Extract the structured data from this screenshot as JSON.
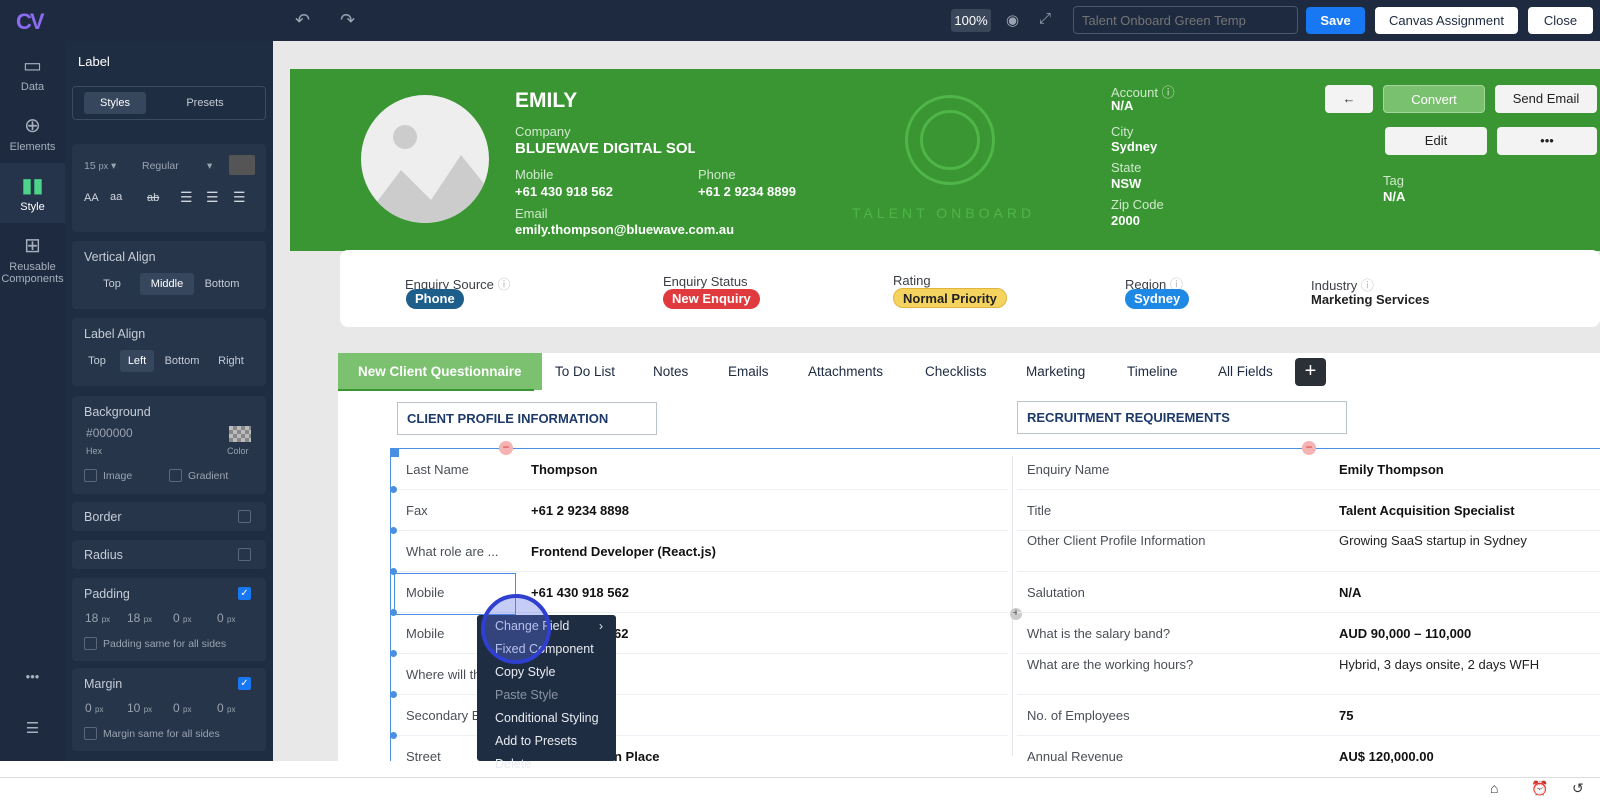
{
  "app": {
    "logo": "CV"
  },
  "toolbar": {
    "zoom": "100%",
    "template_placeholder": "Talent Onboard Green Temp",
    "save": "Save",
    "canvas_assignment": "Canvas Assignment",
    "close": "Close"
  },
  "leftnav": {
    "items": [
      {
        "label": "Data",
        "icon": "data-icon"
      },
      {
        "label": "Elements",
        "icon": "plus-circle-icon"
      },
      {
        "label": "Style",
        "icon": "style-icon"
      },
      {
        "label": "Reusable Components",
        "icon": "components-icon"
      }
    ],
    "more": "•••",
    "menu": "☰"
  },
  "panel": {
    "title": "Label",
    "tabs": [
      "Styles",
      "Presets"
    ],
    "font_size": "15",
    "font_unit": "px",
    "font_weight": "Regular",
    "vertical_align": {
      "title": "Vertical Align",
      "options": [
        "Top",
        "Middle",
        "Bottom"
      ],
      "selected": "Middle"
    },
    "label_align": {
      "title": "Label Align",
      "options": [
        "Top",
        "Left",
        "Bottom",
        "Right"
      ],
      "selected": "Left"
    },
    "background": {
      "title": "Background",
      "hex": "000000",
      "hex_label": "Hex",
      "color_label": "Color",
      "image": "Image",
      "gradient": "Gradient"
    },
    "border": "Border",
    "radius": "Radius",
    "padding": {
      "title": "Padding",
      "values": [
        "18",
        "18",
        "0",
        "0"
      ],
      "unit": "px",
      "same": "Padding same for all sides"
    },
    "margin": {
      "title": "Margin",
      "values": [
        "0",
        "10",
        "0",
        "0"
      ],
      "unit": "px",
      "same": "Margin same for all sides"
    }
  },
  "header": {
    "name": "EMILY",
    "company_label": "Company",
    "company": "BLUEWAVE DIGITAL SOLU",
    "mobile_label": "Mobile",
    "mobile": "+61 430 918 562",
    "phone_label": "Phone",
    "phone": "+61 2 9234 8899",
    "email_label": "Email",
    "email": "emily.thompson@bluewave.com.au",
    "brand": "TALENT ONBOARD",
    "account_label": "Account",
    "account": "N/A",
    "city_label": "City",
    "city": "Sydney",
    "state_label": "State",
    "state": "NSW",
    "zip_label": "Zip Code",
    "zip": "2000",
    "tag_label": "Tag",
    "tag": "N/A",
    "btn_back": "←",
    "btn_convert": "Convert",
    "btn_send_email": "Send Email",
    "btn_edit": "Edit",
    "btn_more": "•••"
  },
  "summary": {
    "enquiry_source_label": "Enquiry Source",
    "enquiry_source": "Phone",
    "enquiry_status_label": "Enquiry Status",
    "enquiry_status": "New Enquiry",
    "rating_label": "Rating",
    "rating": "Normal Priority",
    "region_label": "Region",
    "region": "Sydney",
    "industry_label": "Industry",
    "industry": "Marketing Services"
  },
  "tabs": [
    "New Client Questionnaire",
    "To Do List",
    "Notes",
    "Emails",
    "Attachments",
    "Checklists",
    "Marketing",
    "Timeline",
    "All Fields"
  ],
  "sections": {
    "left": "CLIENT PROFILE INFORMATION",
    "right": "RECRUITMENT REQUIREMENTS"
  },
  "left_rows": [
    {
      "label": "Last Name",
      "value": "Thompson"
    },
    {
      "label": "Fax",
      "value": "+61 2 9234 8898"
    },
    {
      "label": "What role are ...",
      "value": "Frontend Developer (React.js)"
    },
    {
      "label": "Mobile",
      "value": "+61 430 918 562"
    },
    {
      "label": "Mobile",
      "value": "62"
    },
    {
      "label": "Where will th",
      "value": ""
    },
    {
      "label": "Secondary E",
      "value": ""
    },
    {
      "label": "Street",
      "value": "n Place"
    }
  ],
  "right_rows": [
    {
      "label": "Enquiry Name",
      "value": "Emily Thompson"
    },
    {
      "label": "Title",
      "value": "Talent Acquisition Specialist"
    },
    {
      "label": "Other Client Profile Information",
      "value": "Growing SaaS startup in Sydney"
    },
    {
      "label": "Salutation",
      "value": "N/A"
    },
    {
      "label": "What is the salary band?",
      "value": "AUD 90,000 – 110,000"
    },
    {
      "label": "What are the working hours?",
      "value": "Hybrid, 3 days onsite, 2 days WFH"
    },
    {
      "label": "No. of Employees",
      "value": "75"
    },
    {
      "label": "Annual Revenue",
      "value": "AU$ 120,000.00"
    }
  ],
  "context_menu": [
    "Change Field",
    "Fixed Component",
    "Copy Style",
    "Paste Style",
    "Conditional Styling",
    "Add to Presets",
    "Delete"
  ]
}
